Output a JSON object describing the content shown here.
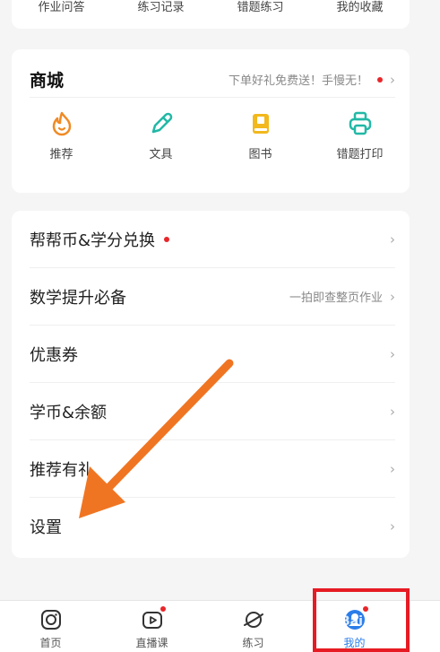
{
  "top_row": [
    "作业问答",
    "练习记录",
    "错题练习",
    "我的收藏"
  ],
  "shop": {
    "title": "商城",
    "promo": "下单好礼免费送！手慢无！",
    "items": [
      {
        "label": "推荐",
        "icon": "flame-icon",
        "color": "#f08a24"
      },
      {
        "label": "文具",
        "icon": "pencil-icon",
        "color": "#22b8a6"
      },
      {
        "label": "图书",
        "icon": "book-icon",
        "color": "#f2b81c"
      },
      {
        "label": "错题打印",
        "icon": "printer-icon",
        "color": "#22b8a6"
      }
    ]
  },
  "menu": {
    "items": [
      {
        "label": "帮帮币&学分兑换",
        "badge": true,
        "right": ""
      },
      {
        "label": "数学提升必备",
        "badge": false,
        "right": "一拍即查整页作业"
      },
      {
        "label": "优惠券",
        "badge": false,
        "right": ""
      },
      {
        "label": "学币&余额",
        "badge": false,
        "right": ""
      },
      {
        "label": "推荐有礼",
        "badge": false,
        "right": ""
      },
      {
        "label": "设置",
        "badge": false,
        "right": ""
      }
    ]
  },
  "tabs": [
    {
      "label": "首页",
      "icon": "home-camera-icon"
    },
    {
      "label": "直播课",
      "icon": "live-video-icon",
      "badge": true
    },
    {
      "label": "练习",
      "icon": "planet-icon"
    },
    {
      "label": "我的",
      "icon": "profile-icon",
      "badge": true,
      "active": true
    }
  ],
  "watermark": "Bai 经验",
  "colors": {
    "accent": "#2b7de9",
    "badge": "#e8262a",
    "arrow": "#f07522",
    "highlight": "#e61b23"
  }
}
